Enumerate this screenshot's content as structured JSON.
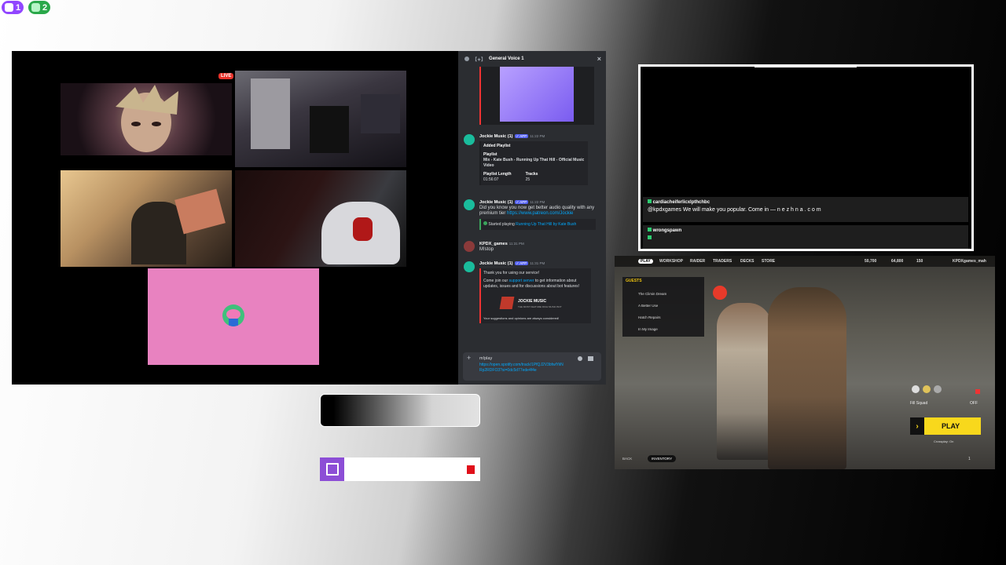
{
  "badges": [
    {
      "icon": "twitch-icon",
      "count": "1",
      "color": "#9146ff"
    },
    {
      "icon": "spotify-icon",
      "count": "2",
      "color": "#1db954"
    }
  ],
  "call": {
    "live_label": "LIVE"
  },
  "discord": {
    "channel_title": "General Voice 1",
    "messages": [
      {
        "author": "Jockie Music (1)",
        "app_tag": "✓ APP",
        "time": "11:22 PM",
        "embed_title": "Added Playlist",
        "playlist_label": "Playlist",
        "playlist_name": "Mix - Kate Bush - Running Up That Hill - Official Music Video",
        "length_label": "Playlist Length",
        "length_value": "01:56:07",
        "tracks_label": "Tracks",
        "tracks_value": "25"
      },
      {
        "author": "Jockie Music (1)",
        "app_tag": "✓ APP",
        "time": "11:22 PM",
        "text": "Did you know you now get better audio quality with any premium tier",
        "link": "https://www.patreon.com/Jockie",
        "now_playing_prefix": "Started playing",
        "now_playing": "Running Up That Hill by Kate Bush"
      },
      {
        "author": "KPDX_games",
        "time": "11:31 PM",
        "text": "M!stop"
      },
      {
        "author": "Jockie Music (1)",
        "app_tag": "✓ APP",
        "time": "11:31 PM",
        "line1": "Thank you for using our service!",
        "line2_a": "Come join our",
        "line2_link": "support server",
        "line2_b": "to get information about updates, issues and for discussions about bot features!",
        "banner_title": "JOCKIE MUSIC",
        "banner_sub": "THE MOST FEATURE RICH MUSIC BOT",
        "footer": "Your suggestions and opinions are always considered!"
      }
    ],
    "composer": {
      "command": "m!play",
      "url": "https://open.spotify.com/track/1PfQJ2V3bfwlYiiNRp2RDFO3?si=0dc5d77ede4f4e"
    }
  },
  "chat": {
    "messages": [
      {
        "user": "cardiacheiferlicxlpthchbc",
        "text": "@kpdxgames We will make you popular. Come in — n e z h n a . c o m",
        "color": "#ffffff"
      },
      {
        "user": "wrongspawn",
        "text": "",
        "color": "#ffffff"
      }
    ]
  },
  "game": {
    "nav": [
      "PLAY",
      "WORKSHOP",
      "RAIDER",
      "TRADERS",
      "DECKS",
      "STORE"
    ],
    "currency": [
      "50,700",
      "64,800",
      "150"
    ],
    "player": "KPDXgames_mah",
    "guests_title": "GUESTS",
    "guests": [
      "The Climin Dream",
      "A Better Use",
      "Hatch Repairs",
      "In My Image"
    ],
    "fill_squad_label": "Fill Squad",
    "fill_squad_value": "OFF",
    "play_label": "PLAY",
    "crossplay": "Crossplay: On",
    "back_label": "BACK",
    "inventory_label": "INVENTORY",
    "squad_count": "1"
  },
  "colors": {
    "discord_bg": "#2b2d31",
    "blurple": "#5865f2",
    "pink_tile": "#e882c0",
    "play_yellow": "#f8d81c",
    "twitch_purple": "#9146ff"
  }
}
